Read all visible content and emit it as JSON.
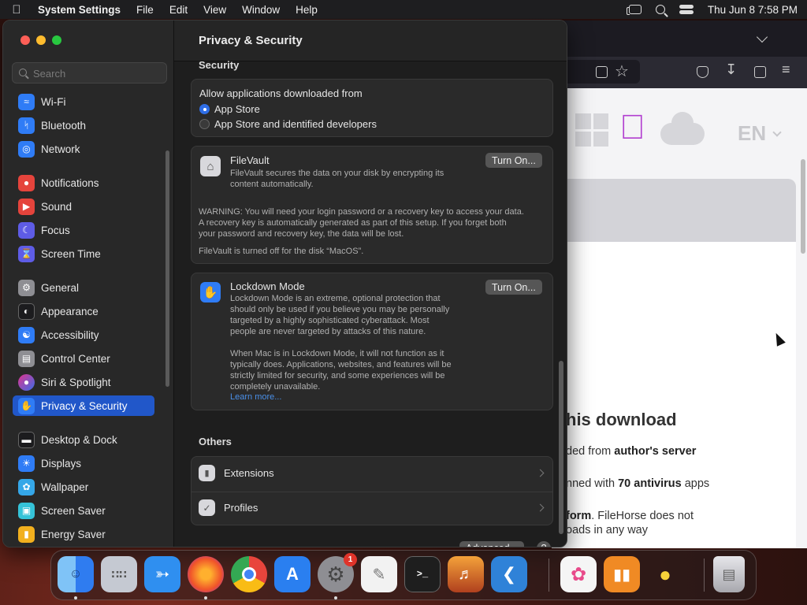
{
  "menubar": {
    "app_name": "System Settings",
    "menus": [
      "File",
      "Edit",
      "View",
      "Window",
      "Help"
    ],
    "datetime": "Thu Jun 8  7:58 PM"
  },
  "sidebar": {
    "search_placeholder": "Search",
    "items": [
      {
        "label": "Wi-Fi",
        "icon": "wifi-icon",
        "color": "#2f7cf6"
      },
      {
        "label": "Bluetooth",
        "icon": "bluetooth-icon",
        "color": "#2f7cf6"
      },
      {
        "label": "Network",
        "icon": "globe-icon",
        "color": "#2f7cf6"
      },
      {
        "label": "Notifications",
        "icon": "bell-icon",
        "color": "#e5443c"
      },
      {
        "label": "Sound",
        "icon": "speaker-icon",
        "color": "#e5443c"
      },
      {
        "label": "Focus",
        "icon": "moon-icon",
        "color": "#5e5ce6"
      },
      {
        "label": "Screen Time",
        "icon": "hourglass-icon",
        "color": "#5e5ce6"
      },
      {
        "label": "General",
        "icon": "gear-icon",
        "color": "#8e8e93"
      },
      {
        "label": "Appearance",
        "icon": "appearance-icon",
        "color": "#1c1c1e"
      },
      {
        "label": "Accessibility",
        "icon": "accessibility-icon",
        "color": "#2f7cf6"
      },
      {
        "label": "Control Center",
        "icon": "control-center-icon",
        "color": "#8e8e93"
      },
      {
        "label": "Siri & Spotlight",
        "icon": "siri-icon",
        "color": "#6a3bd8"
      },
      {
        "label": "Privacy & Security",
        "icon": "hand-icon",
        "color": "#2f7cf6"
      },
      {
        "label": "Desktop & Dock",
        "icon": "dock-icon",
        "color": "#1c1c1e"
      },
      {
        "label": "Displays",
        "icon": "sun-icon",
        "color": "#2f7cf6"
      },
      {
        "label": "Wallpaper",
        "icon": "wallpaper-icon",
        "color": "#35a7e8"
      },
      {
        "label": "Screen Saver",
        "icon": "screen-saver-icon",
        "color": "#35c3d8"
      },
      {
        "label": "Energy Saver",
        "icon": "battery-icon",
        "color": "#f2b01e"
      }
    ]
  },
  "main": {
    "title": "Privacy & Security",
    "security_label": "Security",
    "allow_label": "Allow applications downloaded from",
    "radio_app_store": "App Store",
    "radio_identified": "App Store and identified developers",
    "filevault": {
      "title": "FileVault",
      "desc_1": "FileVault secures the data on your disk by encrypting its",
      "desc_2": "content automatically.",
      "button": "Turn On...",
      "warn_1": "WARNING: You will need your login password or a recovery key to access your data.",
      "warn_2": "A recovery key is automatically generated as part of this setup. If you forget both",
      "warn_3": "your password and recovery key, the data will be lost.",
      "status": "FileVault is turned off for the disk “MacOS”."
    },
    "lockdown": {
      "title": "Lockdown Mode",
      "button": "Turn On...",
      "desc_1": "Lockdown Mode is an extreme, optional protection that",
      "desc_2": "should only be used if you believe you may be personally",
      "desc_3": "targeted by a highly sophisticated cyberattack. Most",
      "desc_4": "people are never targeted by attacks of this nature.",
      "desc_5": "When Mac is in Lockdown Mode, it will not function as it",
      "desc_6": "typically does. Applications, websites, and features will be",
      "desc_7": "strictly limited for security, and some experiences will be",
      "desc_8": "completely unavailable.",
      "learn_more": "Learn more..."
    },
    "others_label": "Others",
    "extensions": "Extensions",
    "profiles": "Profiles",
    "advanced_button": "Advanced...",
    "help_button": "?"
  },
  "browser": {
    "lang": "EN",
    "heading": "his download",
    "line1_pre": "ded from ",
    "line1_bold": "author's server",
    "line2_pre": "nned with ",
    "line2_bold": "70 antivirus",
    "line2_post": " apps",
    "line3_bold": "form",
    "line3_post": ". FileHorse does not",
    "line4": "oads in any way"
  },
  "dock": {
    "apps": [
      {
        "name": "Finder",
        "color": "#3a8df0"
      },
      {
        "name": "Launchpad",
        "color": "#9aa3b5"
      },
      {
        "name": "Safari",
        "color": "#2f8ff0"
      },
      {
        "name": "Firefox",
        "color": "#f46a1f"
      },
      {
        "name": "Chrome",
        "color": "#e8e8e8"
      },
      {
        "name": "App Store",
        "color": "#2a7ff0"
      },
      {
        "name": "System Settings",
        "color": "#8e8e93"
      },
      {
        "name": "TextEdit",
        "color": "#f2f2f2"
      },
      {
        "name": "Terminal",
        "color": "#1e1e1e"
      },
      {
        "name": "GarageBand",
        "color": "#f08a24"
      },
      {
        "name": "Visual Studio Code",
        "color": "#2f82d8"
      },
      {
        "name": "Photos",
        "color": "#f5f5f5"
      },
      {
        "name": "Books",
        "color": "#f08a24"
      },
      {
        "name": "Cyberduck",
        "color": "#2a2a2a"
      },
      {
        "name": "Trash",
        "color": "#c8c8cc"
      }
    ],
    "settings_badge": "1"
  }
}
